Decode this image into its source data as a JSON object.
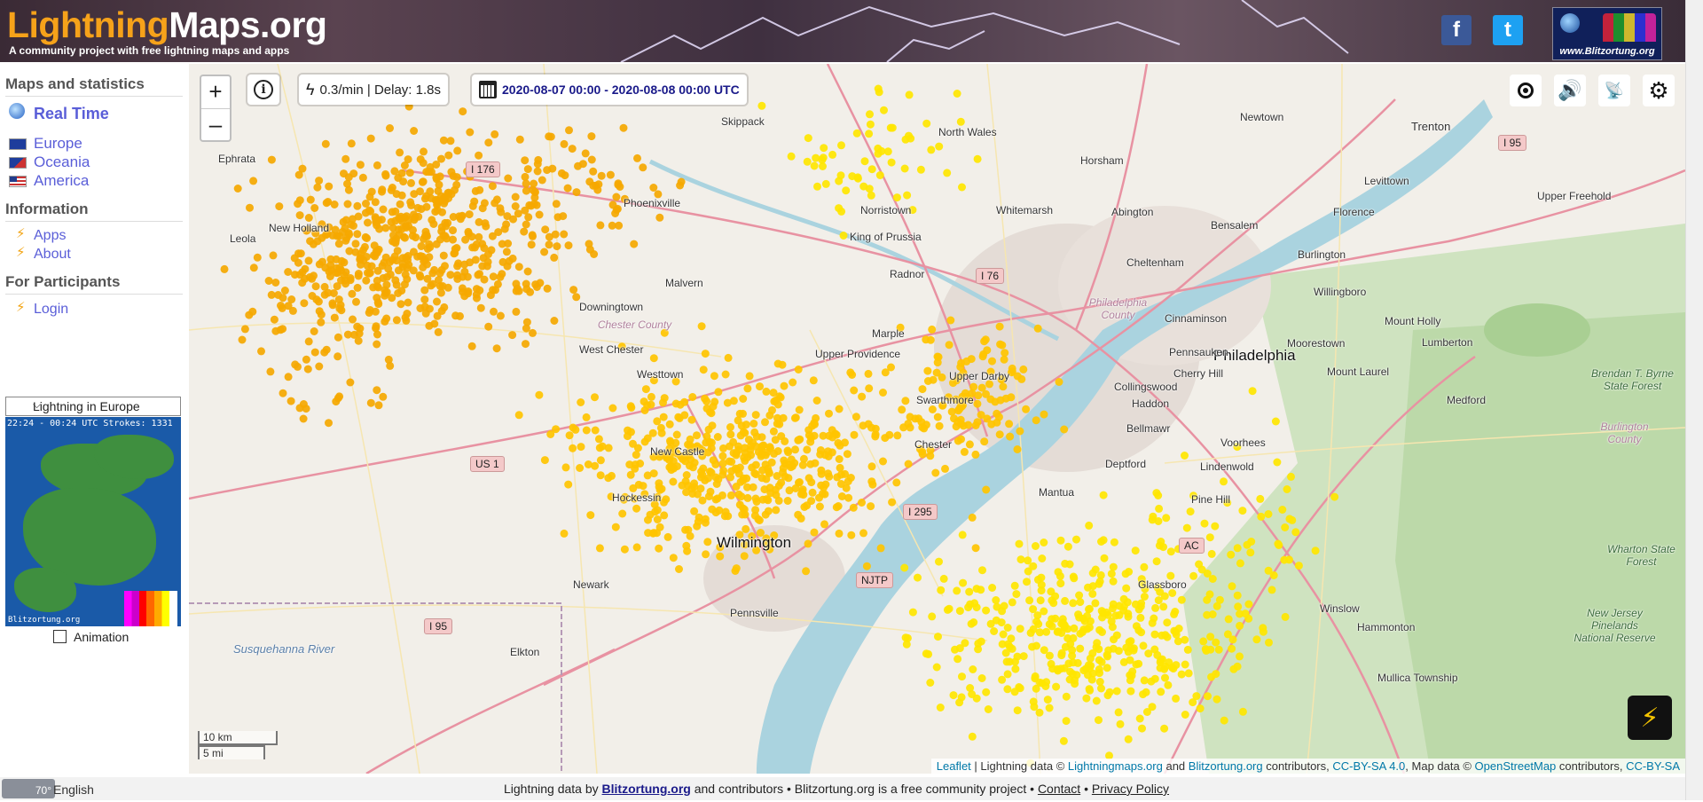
{
  "header": {
    "logo_part1": "Lightning",
    "logo_part2": "Maps.org",
    "tagline": "A community project with free lightning maps and apps",
    "facebook_glyph": "f",
    "twitter_glyph": "t",
    "banner_text": "www.Blitzortung.org"
  },
  "sidebar": {
    "maps_title": "Maps and statistics",
    "realtime_label": "Real Time",
    "regions": [
      "Europe",
      "Oceania",
      "America"
    ],
    "info_title": "Information",
    "info_items": [
      "Apps",
      "About"
    ],
    "participants_title": "For Participants",
    "login_label": "Login",
    "mini_select_value": "Lightning in Europe",
    "mini_map_header": "22:24 - 00:24 UTC Strokes: 1331",
    "mini_map_footer": "Blitzortung.org",
    "animation_label": "Animation"
  },
  "map": {
    "zoom_in": "+",
    "zoom_out": "–",
    "info_glyph": "i",
    "rate_text": "0.3/min | Delay: 1.8s",
    "date_range": "2020-08-07 00:00 - 2020-08-08 00:00 UTC",
    "scale_km": "10 km",
    "scale_mi": "5 mi",
    "attribution": {
      "leaflet": "Leaflet",
      "sep1": " | Lightning data © ",
      "lm": "Lightningmaps.org",
      "and": " and ",
      "bo": "Blitzortung.org",
      "contrib": " contributors, ",
      "cc": "CC-BY-SA 4.0",
      "mapdata": ", Map data © ",
      "osm": "OpenStreetMap",
      "contrib2": " contributors, ",
      "cc2": "CC-BY-SA"
    },
    "labels": [
      {
        "t": "Philadelphia",
        "c": "city"
      },
      {
        "t": "Wilmington",
        "c": "city"
      },
      {
        "t": "Trenton",
        "c": "town"
      },
      {
        "t": "Skippack",
        "c": ""
      },
      {
        "t": "North Wales",
        "c": ""
      },
      {
        "t": "Horsham",
        "c": ""
      },
      {
        "t": "Newtown",
        "c": ""
      },
      {
        "t": "Levittown",
        "c": ""
      },
      {
        "t": "Upper Freehold",
        "c": ""
      },
      {
        "t": "Phoenixville",
        "c": ""
      },
      {
        "t": "Norristown",
        "c": ""
      },
      {
        "t": "Whitemarsh",
        "c": ""
      },
      {
        "t": "Abington",
        "c": ""
      },
      {
        "t": "Bensalem",
        "c": ""
      },
      {
        "t": "Florence",
        "c": ""
      },
      {
        "t": "King of Prussia",
        "c": ""
      },
      {
        "t": "Burlington",
        "c": ""
      },
      {
        "t": "Cheltenham",
        "c": ""
      },
      {
        "t": "New Holland",
        "c": ""
      },
      {
        "t": "Malvern",
        "c": ""
      },
      {
        "t": "Radnor",
        "c": ""
      },
      {
        "t": "Willingboro",
        "c": ""
      },
      {
        "t": "Downingtown",
        "c": ""
      },
      {
        "t": "Marple",
        "c": ""
      },
      {
        "t": "Cinnaminson",
        "c": ""
      },
      {
        "t": "Mount Holly",
        "c": ""
      },
      {
        "t": "West Chester",
        "c": ""
      },
      {
        "t": "Upper Providence",
        "c": ""
      },
      {
        "t": "Pennsauken",
        "c": ""
      },
      {
        "t": "Moorestown",
        "c": ""
      },
      {
        "t": "Lumberton",
        "c": ""
      },
      {
        "t": "Westtown",
        "c": ""
      },
      {
        "t": "Upper Darby",
        "c": ""
      },
      {
        "t": "Cherry Hill",
        "c": ""
      },
      {
        "t": "Mount Laurel",
        "c": ""
      },
      {
        "t": "Collingswood",
        "c": ""
      },
      {
        "t": "Swarthmore",
        "c": ""
      },
      {
        "t": "Haddon",
        "c": ""
      },
      {
        "t": "Medford",
        "c": ""
      },
      {
        "t": "Bellmawr",
        "c": ""
      },
      {
        "t": "Chester",
        "c": ""
      },
      {
        "t": "Voorhees",
        "c": ""
      },
      {
        "t": "Deptford",
        "c": ""
      },
      {
        "t": "Lindenwold",
        "c": ""
      },
      {
        "t": "New Castle",
        "c": ""
      },
      {
        "t": "Hockessin",
        "c": ""
      },
      {
        "t": "Mantua",
        "c": ""
      },
      {
        "t": "Pine Hill",
        "c": ""
      },
      {
        "t": "Newark",
        "c": ""
      },
      {
        "t": "Glassboro",
        "c": ""
      },
      {
        "t": "Pennsville",
        "c": ""
      },
      {
        "t": "Winslow",
        "c": ""
      },
      {
        "t": "Elkton",
        "c": ""
      },
      {
        "t": "Hammonton",
        "c": ""
      },
      {
        "t": "Mullica Township",
        "c": ""
      },
      {
        "t": "Ephrata",
        "c": ""
      },
      {
        "t": "Leola",
        "c": ""
      },
      {
        "t": "Brendan T. Byrne State Forest",
        "c": "green"
      },
      {
        "t": "Wharton State Forest",
        "c": "green"
      },
      {
        "t": "New Jersey Pinelands National Reserve",
        "c": "green"
      },
      {
        "t": "Burlington County",
        "c": "county"
      },
      {
        "t": "Philadelphia County",
        "c": "county"
      },
      {
        "t": "Chester County",
        "c": "county"
      },
      {
        "t": "Susquehanna River",
        "c": "river"
      }
    ],
    "shields": [
      "I 176",
      "I 76",
      "I 95",
      "US 1",
      "I 295",
      "NJTP",
      "I 95",
      "AC"
    ]
  },
  "footer": {
    "weather_temp": "70°",
    "language": "English",
    "text1": "Lightning data by ",
    "blitz_link": "Blitzortung.org",
    "text2": " and contributors • Blitzortung.org is a free community project • ",
    "contact": "Contact",
    "sep": " • ",
    "privacy": "Privacy Policy"
  },
  "colors": {
    "strike_old": "#f5a800",
    "strike_mid": "#ffc400",
    "strike_new": "#ffe600",
    "link": "#5a5ed8",
    "accent": "#f6a21a"
  }
}
